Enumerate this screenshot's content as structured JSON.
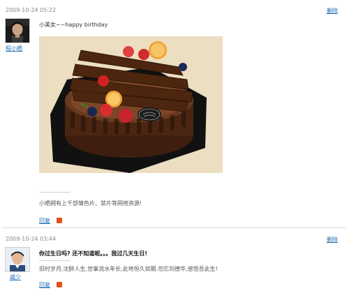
{
  "posts": [
    {
      "timestamp": "2009-10-24 05:22",
      "delete_label": "删除",
      "username": "程小晒",
      "message": "小美女~~happy birthday",
      "image_alt": "chocolate birthday cake",
      "separator": "--------------------",
      "signature": "小晒拥有上千部情色片、禁片等网络资源!",
      "reply_label": "回复",
      "rss_icon": "rss-icon"
    },
    {
      "timestamp": "2009-10-24 03:44",
      "delete_label": "删除",
      "username": "威少",
      "message": "你过生日吗? 还不知道呢。。。我过几天生日!",
      "separator": "--------------------",
      "signature": "旧时岁月,沈醉人生,世事流水年长,此地恒久如期.勿忘刘德华,感悟吾此生!",
      "reply_label": "回复",
      "rss_icon": "rss-icon"
    }
  ],
  "colors": {
    "link": "#1a6db5",
    "timestamp": "#888888",
    "divider": "#dcdcdc",
    "rss": "#e2531b"
  }
}
